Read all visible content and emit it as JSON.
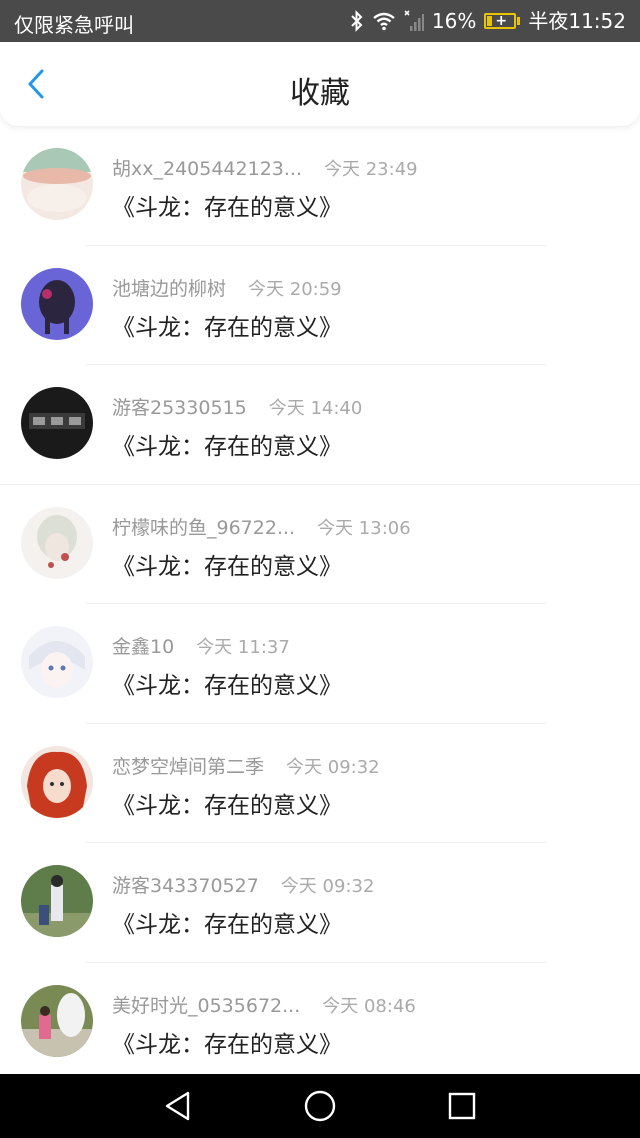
{
  "status_bar": {
    "carrier": "仅限紧急呼叫",
    "battery_percent": "16%",
    "time": "半夜11:52",
    "icons": [
      "bluetooth-icon",
      "wifi-icon",
      "signal-icon",
      "battery-charging-icon"
    ],
    "battery_color": "#e9c400"
  },
  "header": {
    "title": "收藏",
    "back_icon": "chevron-left-icon",
    "accent_color": "#2196f3"
  },
  "favorites": [
    {
      "user": "胡xx_2405442123...",
      "time": "今天 23:49",
      "title": "《斗龙：存在的意义》"
    },
    {
      "user": "池塘边的柳树",
      "time": "今天 20:59",
      "title": "《斗龙：存在的意义》"
    },
    {
      "user": "游客25330515",
      "time": "今天 14:40",
      "title": "《斗龙：存在的意义》"
    },
    {
      "user": "柠檬味的鱼_96722...",
      "time": "今天 13:06",
      "title": "《斗龙：存在的意义》"
    },
    {
      "user": "金鑫10",
      "time": "今天 11:37",
      "title": "《斗龙：存在的意义》"
    },
    {
      "user": "恋梦空焯间第二季",
      "time": "今天 09:32",
      "title": "《斗龙：存在的意义》"
    },
    {
      "user": "游客343370527",
      "time": "今天 09:32",
      "title": "《斗龙：存在的意义》"
    },
    {
      "user": "美好时光_0535672...",
      "time": "今天 08:46",
      "title": "《斗龙：存在的意义》"
    }
  ],
  "nav_bar": {
    "icons": [
      "back-triangle-icon",
      "home-circle-icon",
      "recents-square-icon"
    ]
  }
}
